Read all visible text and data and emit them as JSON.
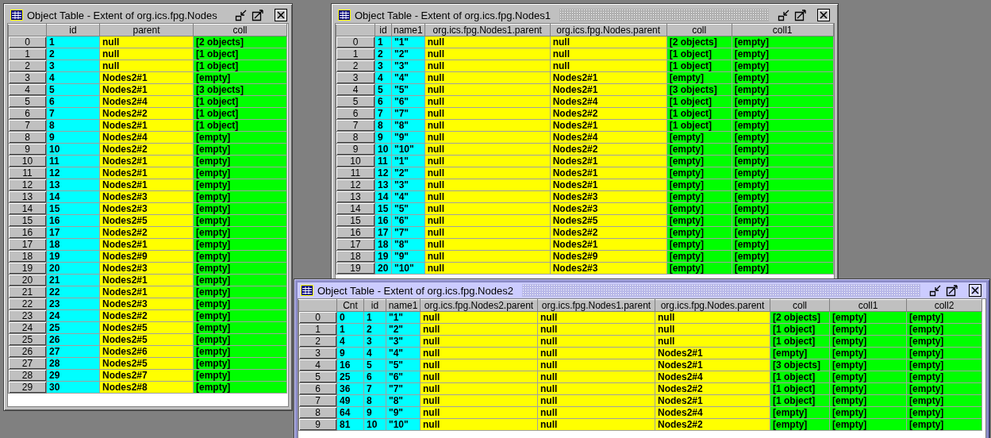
{
  "windows": [
    {
      "title": "Object Table - Extent of org.ics.fpg.Nodes",
      "active": false,
      "columns": [
        {
          "label": "id",
          "color": "#00ffff"
        },
        {
          "label": "parent",
          "color": "#ffff00"
        },
        {
          "label": "coll",
          "color": "#00ff00"
        }
      ],
      "rows": [
        {
          "index": "0",
          "cells": [
            "1",
            "null",
            "[2 objects]"
          ]
        },
        {
          "index": "1",
          "cells": [
            "2",
            "null",
            "[1 object]"
          ]
        },
        {
          "index": "2",
          "cells": [
            "3",
            "null",
            "[1 object]"
          ]
        },
        {
          "index": "3",
          "cells": [
            "4",
            "Nodes2#1",
            "[empty]"
          ]
        },
        {
          "index": "4",
          "cells": [
            "5",
            "Nodes2#1",
            "[3 objects]"
          ]
        },
        {
          "index": "5",
          "cells": [
            "6",
            "Nodes2#4",
            "[1 object]"
          ]
        },
        {
          "index": "6",
          "cells": [
            "7",
            "Nodes2#2",
            "[1 object]"
          ]
        },
        {
          "index": "7",
          "cells": [
            "8",
            "Nodes2#1",
            "[1 object]"
          ]
        },
        {
          "index": "8",
          "cells": [
            "9",
            "Nodes2#4",
            "[empty]"
          ]
        },
        {
          "index": "9",
          "cells": [
            "10",
            "Nodes2#2",
            "[empty]"
          ]
        },
        {
          "index": "10",
          "cells": [
            "11",
            "Nodes2#1",
            "[empty]"
          ]
        },
        {
          "index": "11",
          "cells": [
            "12",
            "Nodes2#1",
            "[empty]"
          ]
        },
        {
          "index": "12",
          "cells": [
            "13",
            "Nodes2#1",
            "[empty]"
          ]
        },
        {
          "index": "13",
          "cells": [
            "14",
            "Nodes2#3",
            "[empty]"
          ]
        },
        {
          "index": "14",
          "cells": [
            "15",
            "Nodes2#3",
            "[empty]"
          ]
        },
        {
          "index": "15",
          "cells": [
            "16",
            "Nodes2#5",
            "[empty]"
          ]
        },
        {
          "index": "16",
          "cells": [
            "17",
            "Nodes2#2",
            "[empty]"
          ]
        },
        {
          "index": "17",
          "cells": [
            "18",
            "Nodes2#1",
            "[empty]"
          ]
        },
        {
          "index": "18",
          "cells": [
            "19",
            "Nodes2#9",
            "[empty]"
          ]
        },
        {
          "index": "19",
          "cells": [
            "20",
            "Nodes2#3",
            "[empty]"
          ]
        },
        {
          "index": "20",
          "cells": [
            "21",
            "Nodes2#1",
            "[empty]"
          ]
        },
        {
          "index": "21",
          "cells": [
            "22",
            "Nodes2#1",
            "[empty]"
          ]
        },
        {
          "index": "22",
          "cells": [
            "23",
            "Nodes2#3",
            "[empty]"
          ]
        },
        {
          "index": "23",
          "cells": [
            "24",
            "Nodes2#2",
            "[empty]"
          ]
        },
        {
          "index": "24",
          "cells": [
            "25",
            "Nodes2#5",
            "[empty]"
          ]
        },
        {
          "index": "25",
          "cells": [
            "26",
            "Nodes2#5",
            "[empty]"
          ]
        },
        {
          "index": "26",
          "cells": [
            "27",
            "Nodes2#6",
            "[empty]"
          ]
        },
        {
          "index": "27",
          "cells": [
            "28",
            "Nodes2#5",
            "[empty]"
          ]
        },
        {
          "index": "28",
          "cells": [
            "29",
            "Nodes2#7",
            "[empty]"
          ]
        },
        {
          "index": "29",
          "cells": [
            "30",
            "Nodes2#8",
            "[empty]"
          ]
        }
      ]
    },
    {
      "title": "Object Table - Extent of org.ics.fpg.Nodes1",
      "active": false,
      "columns": [
        {
          "label": "id",
          "color": "#00ffff"
        },
        {
          "label": "name1",
          "color": "#00ffff"
        },
        {
          "label": "org.ics.fpg.Nodes1.parent",
          "color": "#ffff00"
        },
        {
          "label": "org.ics.fpg.Nodes.parent",
          "color": "#ffff00"
        },
        {
          "label": "coll",
          "color": "#00ff00"
        },
        {
          "label": "coll1",
          "color": "#00ff00"
        }
      ],
      "rows": [
        {
          "index": "0",
          "cells": [
            "1",
            "\"1\"",
            "null",
            "null",
            "[2 objects]",
            "[empty]"
          ]
        },
        {
          "index": "1",
          "cells": [
            "2",
            "\"2\"",
            "null",
            "null",
            "[1 object]",
            "[empty]"
          ]
        },
        {
          "index": "2",
          "cells": [
            "3",
            "\"3\"",
            "null",
            "null",
            "[1 object]",
            "[empty]"
          ]
        },
        {
          "index": "3",
          "cells": [
            "4",
            "\"4\"",
            "null",
            "Nodes2#1",
            "[empty]",
            "[empty]"
          ]
        },
        {
          "index": "4",
          "cells": [
            "5",
            "\"5\"",
            "null",
            "Nodes2#1",
            "[3 objects]",
            "[empty]"
          ]
        },
        {
          "index": "5",
          "cells": [
            "6",
            "\"6\"",
            "null",
            "Nodes2#4",
            "[1 object]",
            "[empty]"
          ]
        },
        {
          "index": "6",
          "cells": [
            "7",
            "\"7\"",
            "null",
            "Nodes2#2",
            "[1 object]",
            "[empty]"
          ]
        },
        {
          "index": "7",
          "cells": [
            "8",
            "\"8\"",
            "null",
            "Nodes2#1",
            "[1 object]",
            "[empty]"
          ]
        },
        {
          "index": "8",
          "cells": [
            "9",
            "\"9\"",
            "null",
            "Nodes2#4",
            "[empty]",
            "[empty]"
          ]
        },
        {
          "index": "9",
          "cells": [
            "10",
            "\"10\"",
            "null",
            "Nodes2#2",
            "[empty]",
            "[empty]"
          ]
        },
        {
          "index": "10",
          "cells": [
            "11",
            "\"1\"",
            "null",
            "Nodes2#1",
            "[empty]",
            "[empty]"
          ]
        },
        {
          "index": "11",
          "cells": [
            "12",
            "\"2\"",
            "null",
            "Nodes2#1",
            "[empty]",
            "[empty]"
          ]
        },
        {
          "index": "12",
          "cells": [
            "13",
            "\"3\"",
            "null",
            "Nodes2#1",
            "[empty]",
            "[empty]"
          ]
        },
        {
          "index": "13",
          "cells": [
            "14",
            "\"4\"",
            "null",
            "Nodes2#3",
            "[empty]",
            "[empty]"
          ]
        },
        {
          "index": "14",
          "cells": [
            "15",
            "\"5\"",
            "null",
            "Nodes2#3",
            "[empty]",
            "[empty]"
          ]
        },
        {
          "index": "15",
          "cells": [
            "16",
            "\"6\"",
            "null",
            "Nodes2#5",
            "[empty]",
            "[empty]"
          ]
        },
        {
          "index": "16",
          "cells": [
            "17",
            "\"7\"",
            "null",
            "Nodes2#2",
            "[empty]",
            "[empty]"
          ]
        },
        {
          "index": "17",
          "cells": [
            "18",
            "\"8\"",
            "null",
            "Nodes2#1",
            "[empty]",
            "[empty]"
          ]
        },
        {
          "index": "18",
          "cells": [
            "19",
            "\"9\"",
            "null",
            "Nodes2#9",
            "[empty]",
            "[empty]"
          ]
        },
        {
          "index": "19",
          "cells": [
            "20",
            "\"10\"",
            "null",
            "Nodes2#3",
            "[empty]",
            "[empty]"
          ]
        }
      ]
    },
    {
      "title": "Object Table - Extent of org.ics.fpg.Nodes2",
      "active": true,
      "columns": [
        {
          "label": "Cnt",
          "color": "#00ffff"
        },
        {
          "label": "id",
          "color": "#00ffff"
        },
        {
          "label": "name1",
          "color": "#00ffff"
        },
        {
          "label": "org.ics.fpg.Nodes2.parent",
          "color": "#ffff00"
        },
        {
          "label": "org.ics.fpg.Nodes1.parent",
          "color": "#ffff00"
        },
        {
          "label": "org.ics.fpg.Nodes.parent",
          "color": "#ffff00"
        },
        {
          "label": "coll",
          "color": "#00ff00"
        },
        {
          "label": "coll1",
          "color": "#00ff00"
        },
        {
          "label": "coll2",
          "color": "#00ff00"
        }
      ],
      "rows": [
        {
          "index": "0",
          "cells": [
            "0",
            "1",
            "\"1\"",
            "null",
            "null",
            "null",
            "[2 objects]",
            "[empty]",
            "[empty]"
          ]
        },
        {
          "index": "1",
          "cells": [
            "1",
            "2",
            "\"2\"",
            "null",
            "null",
            "null",
            "[1 object]",
            "[empty]",
            "[empty]"
          ]
        },
        {
          "index": "2",
          "cells": [
            "4",
            "3",
            "\"3\"",
            "null",
            "null",
            "null",
            "[1 object]",
            "[empty]",
            "[empty]"
          ]
        },
        {
          "index": "3",
          "cells": [
            "9",
            "4",
            "\"4\"",
            "null",
            "null",
            "Nodes2#1",
            "[empty]",
            "[empty]",
            "[empty]"
          ]
        },
        {
          "index": "4",
          "cells": [
            "16",
            "5",
            "\"5\"",
            "null",
            "null",
            "Nodes2#1",
            "[3 objects]",
            "[empty]",
            "[empty]"
          ]
        },
        {
          "index": "5",
          "cells": [
            "25",
            "6",
            "\"6\"",
            "null",
            "null",
            "Nodes2#4",
            "[1 object]",
            "[empty]",
            "[empty]"
          ]
        },
        {
          "index": "6",
          "cells": [
            "36",
            "7",
            "\"7\"",
            "null",
            "null",
            "Nodes2#2",
            "[1 object]",
            "[empty]",
            "[empty]"
          ]
        },
        {
          "index": "7",
          "cells": [
            "49",
            "8",
            "\"8\"",
            "null",
            "null",
            "Nodes2#1",
            "[1 object]",
            "[empty]",
            "[empty]"
          ]
        },
        {
          "index": "8",
          "cells": [
            "64",
            "9",
            "\"9\"",
            "null",
            "null",
            "Nodes2#4",
            "[empty]",
            "[empty]",
            "[empty]"
          ]
        },
        {
          "index": "9",
          "cells": [
            "81",
            "10",
            "\"10\"",
            "null",
            "null",
            "Nodes2#2",
            "[empty]",
            "[empty]",
            "[empty]"
          ]
        }
      ]
    }
  ]
}
